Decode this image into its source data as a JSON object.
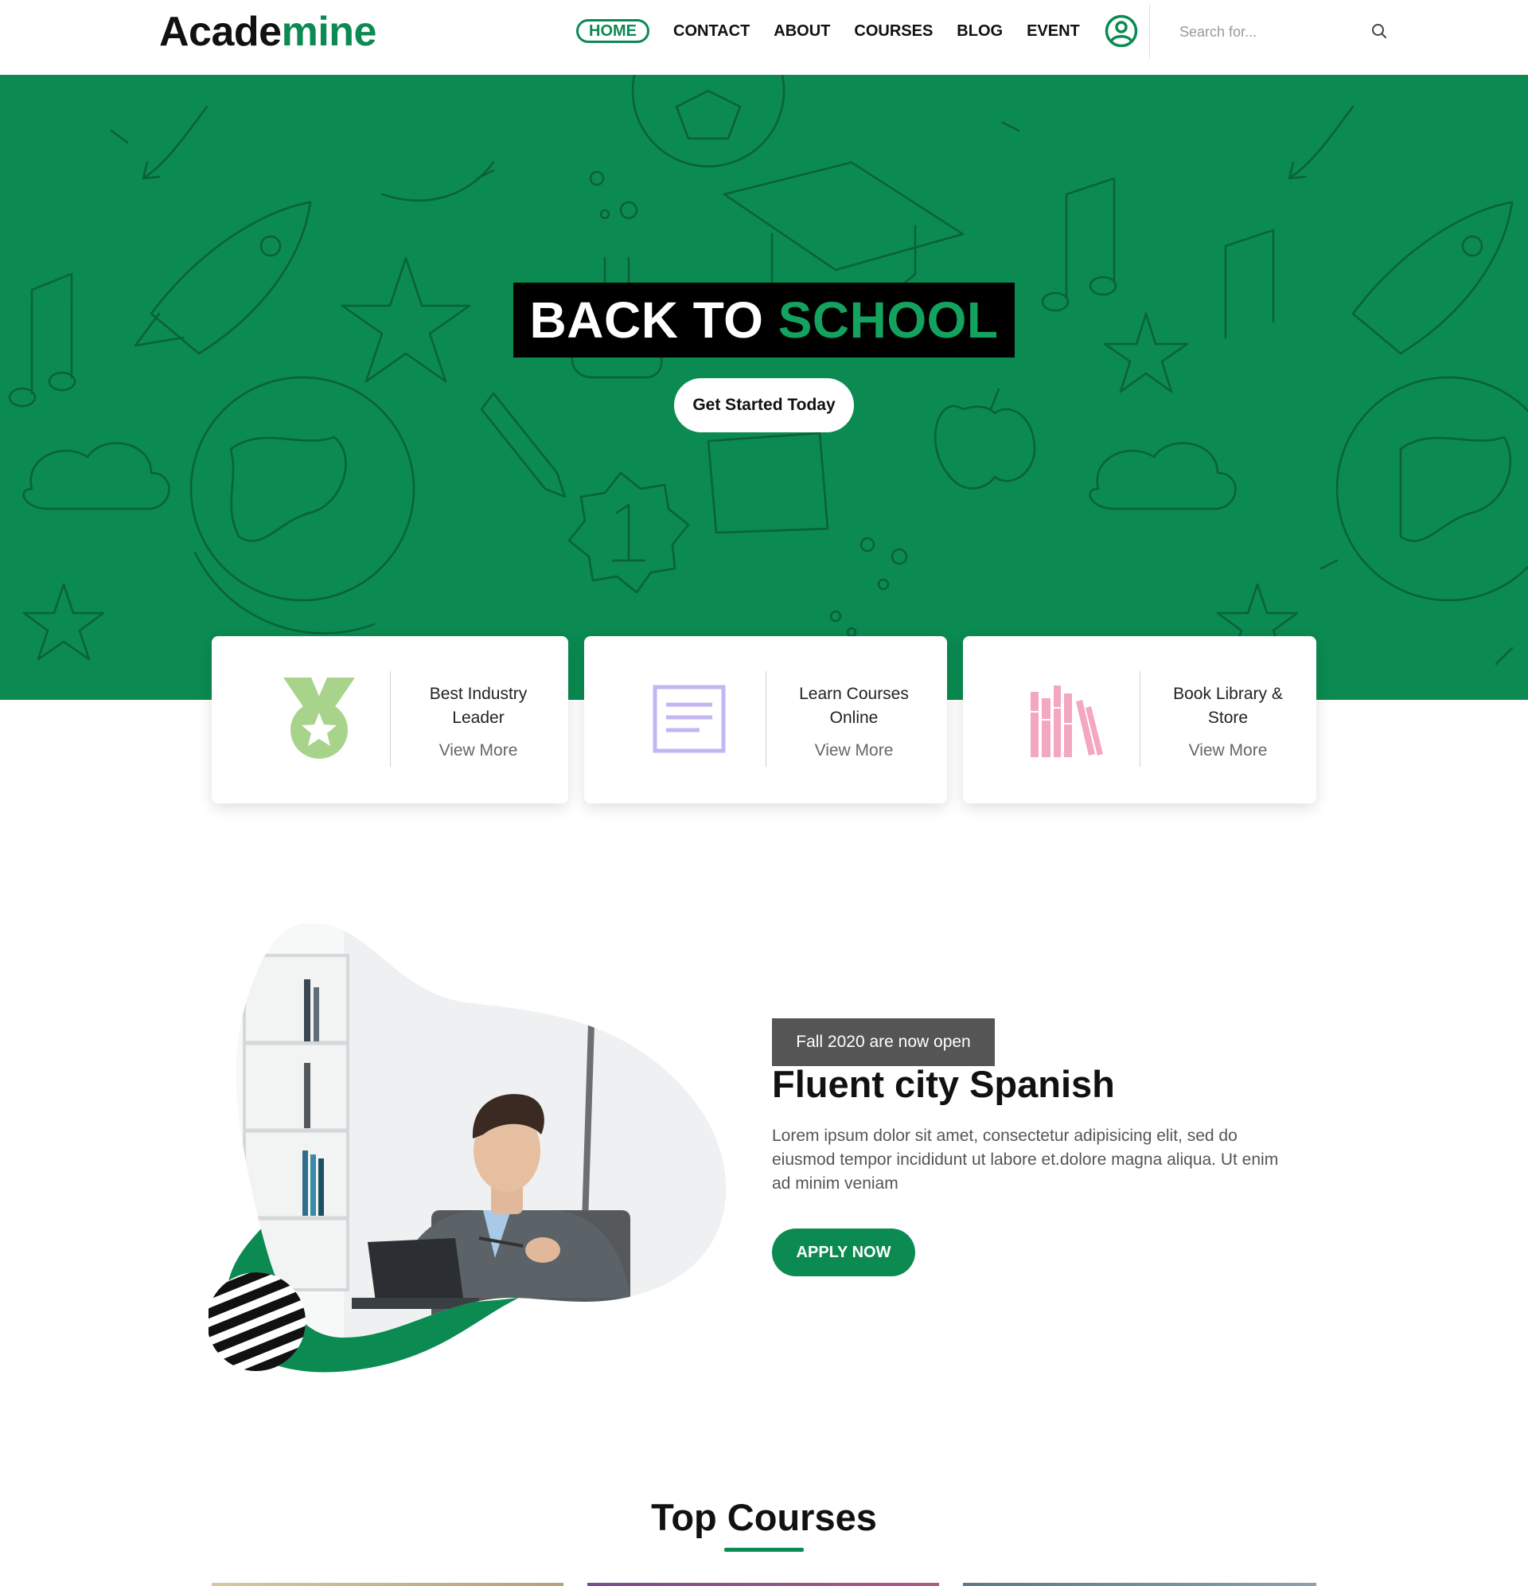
{
  "header": {
    "logo_part1": "Acade",
    "logo_part2": "mine",
    "nav": [
      "HOME",
      "CONTACT",
      "ABOUT",
      "COURSES",
      "BLOG",
      "EVENT"
    ],
    "search_placeholder": "Search for...",
    "icons": [
      "user-icon",
      "search-icon"
    ]
  },
  "hero": {
    "title_part1": "BACK TO",
    "title_part2": "SCHOOL",
    "cta": "Get Started Today"
  },
  "features": [
    {
      "title": "Best Industry Leader",
      "link": "View More",
      "icon": "medal-icon"
    },
    {
      "title": "Learn Courses Online",
      "link": "View More",
      "icon": "document-icon"
    },
    {
      "title": "Book Library & Store",
      "link": "View More",
      "icon": "books-icon"
    }
  ],
  "promo": {
    "badge": "Fall 2020 are now open",
    "title": "Fluent city Spanish",
    "description": "Lorem ipsum dolor sit amet, consectetur adipisicing elit, sed do eiusmod tempor incididunt ut labore et.dolore magna aliqua. Ut enim ad minim veniam",
    "cta": "APPLY NOW"
  },
  "courses": {
    "title": "Top Courses"
  },
  "colors": {
    "brand_green": "#0b8a51",
    "hero_highlight": "#14a35f",
    "medal_icon": "#a8d38a",
    "document_icon": "#c3b6f2",
    "books_icon": "#f4a7c0"
  }
}
